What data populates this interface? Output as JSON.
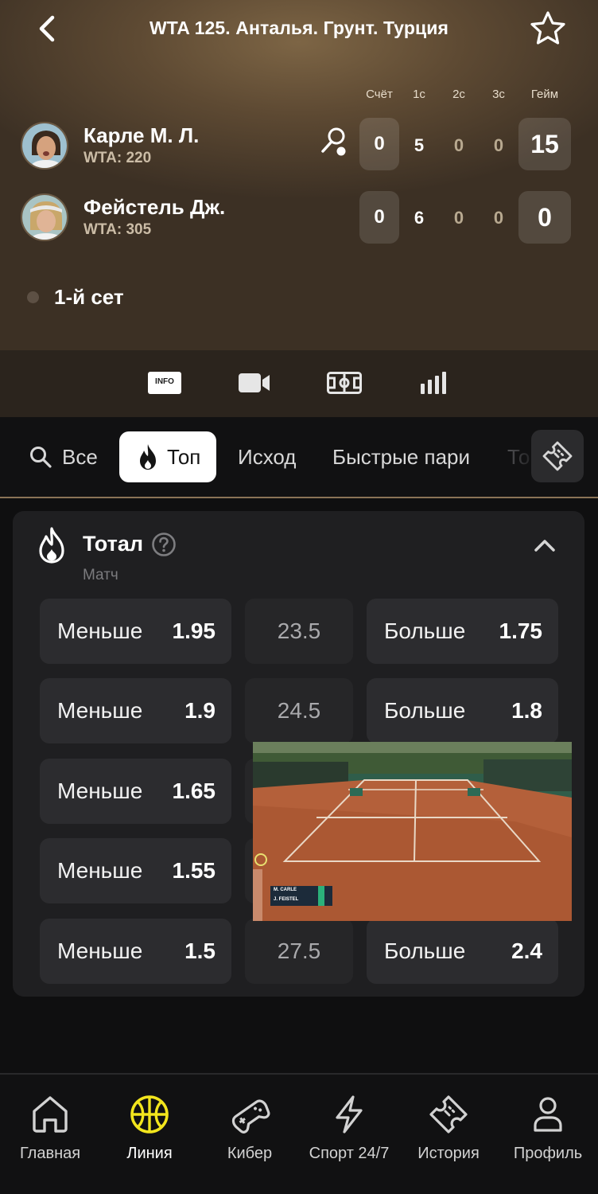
{
  "header": {
    "title": "WTA 125. Анталья. Грунт. Турция",
    "back_icon": "chevron-left-icon",
    "favorite_icon": "star-icon"
  },
  "scoreboard": {
    "columns": [
      "Счёт",
      "1с",
      "2с",
      "3с",
      "Гейм"
    ],
    "players": [
      {
        "name": "Карле М. Л.",
        "rank": "WTA: 220",
        "serving": true,
        "score": "0",
        "sets": [
          "5",
          "0",
          "0"
        ],
        "game": "15"
      },
      {
        "name": "Фейстель Дж.",
        "rank": "WTA: 305",
        "serving": false,
        "score": "0",
        "sets": [
          "6",
          "0",
          "0"
        ],
        "game": "0"
      }
    ],
    "period": "1-й сет"
  },
  "media_tabs": [
    {
      "name": "info",
      "label": "INFO"
    },
    {
      "name": "video",
      "icon": "video-camera-icon"
    },
    {
      "name": "field",
      "icon": "field-icon"
    },
    {
      "name": "stats",
      "icon": "stats-icon"
    }
  ],
  "category_tabs": [
    {
      "label": "Все",
      "icon": "search-icon",
      "active": false
    },
    {
      "label": "Топ",
      "icon": "fire-icon",
      "active": true
    },
    {
      "label": "Исход",
      "active": false
    },
    {
      "label": "Быстрые пари",
      "active": false
    },
    {
      "label": "То",
      "active": false
    }
  ],
  "market": {
    "title": "Тотал",
    "subtitle": "Матч",
    "rows": [
      {
        "under_label": "Меньше",
        "under_odds": "1.95",
        "line": "23.5",
        "over_label": "Больше",
        "over_odds": "1.75"
      },
      {
        "under_label": "Меньше",
        "under_odds": "1.9",
        "line": "24.5",
        "over_label": "Больше",
        "over_odds": "1.8"
      },
      {
        "under_label": "Меньше",
        "under_odds": "1.65",
        "line": "",
        "over_label": "",
        "over_odds": ""
      },
      {
        "under_label": "Меньше",
        "under_odds": "1.55",
        "line": "",
        "over_label": "",
        "over_odds": ""
      },
      {
        "under_label": "Меньше",
        "under_odds": "1.5",
        "line": "27.5",
        "over_label": "Больше",
        "over_odds": "2.4"
      }
    ]
  },
  "video_overlay": {
    "scoreboard_rows": [
      "M. CARLE",
      "J. FEISTEL"
    ]
  },
  "bottom_nav": [
    {
      "label": "Главная",
      "icon": "home-icon",
      "active": false
    },
    {
      "label": "Линия",
      "icon": "basketball-icon",
      "active": true
    },
    {
      "label": "Кибер",
      "icon": "gamepad-icon",
      "active": false
    },
    {
      "label": "Спорт 24/7",
      "icon": "lightning-icon",
      "active": false
    },
    {
      "label": "История",
      "icon": "ticket-icon",
      "active": false
    },
    {
      "label": "Профиль",
      "icon": "user-icon",
      "active": false
    }
  ],
  "colors": {
    "accent": "#f2e51d",
    "card": "#1f1f21",
    "button": "#2c2c2f"
  }
}
